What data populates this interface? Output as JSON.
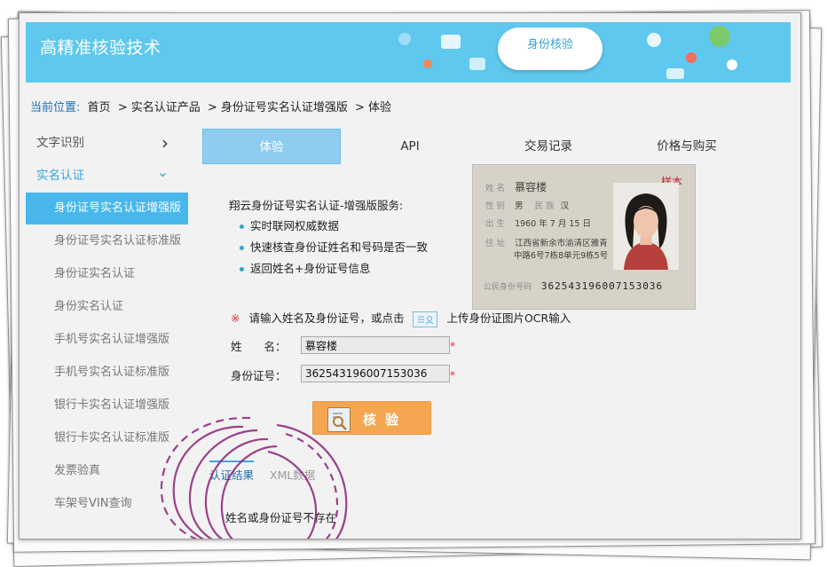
{
  "banner": {
    "brand": "高精准核验技术",
    "badge": "身份核验"
  },
  "breadcrumb": {
    "label": "当前位置:",
    "items": [
      "首页",
      "> 实名认证产品",
      "> 身份证号实名认证增强版",
      "> 体验"
    ]
  },
  "sidebar": {
    "categories": [
      {
        "label": "文字识别",
        "chevron": "›"
      },
      {
        "label": "实名认证",
        "chevron": "⌄"
      }
    ],
    "items": [
      "身份证号实名认证增强版",
      "身份证号实名认证标准版",
      "身份证实名认证",
      "身份实名认证",
      "手机号实名认证增强版",
      "手机号实名认证标准版",
      "银行卡实名认证增强版",
      "银行卡实名认证标准版",
      "发票验真",
      "车架号VIN查询"
    ]
  },
  "tabs": [
    "体验",
    "API",
    "交易记录",
    "价格与购买"
  ],
  "intro": {
    "title": "翔云身份证号实名认证-增强版服务:",
    "bullets": [
      "实时联网权威数据",
      "快速核查身份证姓名和号码是否一致",
      "返回姓名+身份证号信息"
    ]
  },
  "id_card": {
    "sample": "样本",
    "name_label": "姓 名",
    "name": "慕容楼",
    "sex_label": "性 别",
    "sex": "男",
    "nation_label": "民 族",
    "nation": "汉",
    "birth_label": "出 生",
    "birth": "1960 年 7 月 15 日",
    "addr_label": "住 址",
    "addr1": "江西省新余市渝清区雅青",
    "addr2": "中路6号7栋8单元9栋5号",
    "number_label": "公民身份号码",
    "number": "362543196007153036"
  },
  "form": {
    "hint_prefix": "请输入姓名及身份证号，或点击",
    "hint_suffix": "上传身份证图片OCR输入",
    "name_label": "姓　　名：",
    "name_value": "慕容楼",
    "id_label": "身份证号：",
    "id_value": "362543196007153036",
    "required_mark": "*",
    "hint_star": "※",
    "submit_label": "核验"
  },
  "results": {
    "tabs": [
      "认证结果",
      "XML数据"
    ],
    "message": "姓名或身份证号不存在"
  },
  "colors": {
    "banner": "#5ec8ef",
    "active_nav": "#48b7ec",
    "submit": "#f5a651",
    "scribble": "#8e2277"
  }
}
